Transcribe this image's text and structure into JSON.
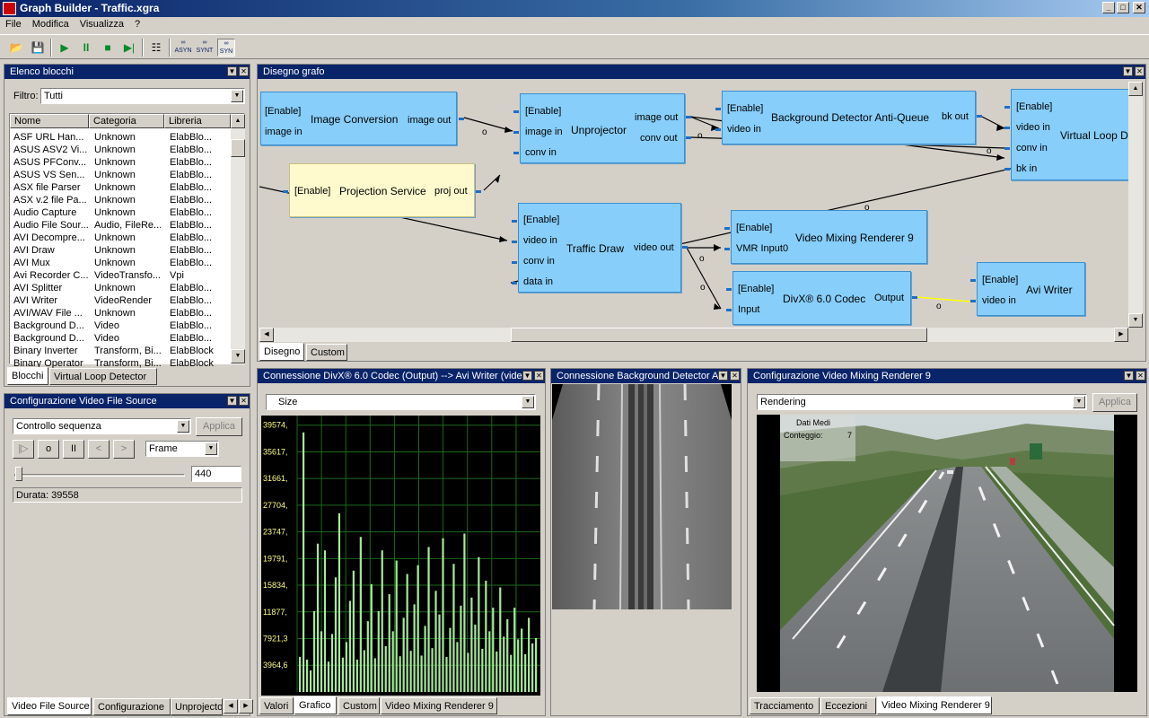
{
  "window": {
    "title": "Graph Builder - Traffic.xgra",
    "min": "_",
    "max": "□",
    "close": "✕"
  },
  "menu": [
    "File",
    "Modifica",
    "Visualizza",
    "?"
  ],
  "toolbar": {
    "asyn": "ASYN",
    "synt": "SYNT",
    "syn": "SYN"
  },
  "blocks_panel": {
    "title": "Elenco blocchi",
    "filter_label": "Filtro:",
    "filter_value": "Tutti",
    "columns": [
      "Nome",
      "Categoria",
      "Libreria"
    ],
    "rows": [
      [
        "ASF URL Han...",
        "Unknown",
        "ElabBlo..."
      ],
      [
        "ASUS ASV2 Vi...",
        "Unknown",
        "ElabBlo..."
      ],
      [
        "ASUS PFConv...",
        "Unknown",
        "ElabBlo..."
      ],
      [
        "ASUS VS Sen...",
        "Unknown",
        "ElabBlo..."
      ],
      [
        "ASX file Parser",
        "Unknown",
        "ElabBlo..."
      ],
      [
        "ASX v.2 file Pa...",
        "Unknown",
        "ElabBlo..."
      ],
      [
        "Audio Capture",
        "Unknown",
        "ElabBlo..."
      ],
      [
        "Audio File Sour...",
        "Audio, FileRe...",
        "ElabBlo..."
      ],
      [
        "AVI Decompre...",
        "Unknown",
        "ElabBlo..."
      ],
      [
        "AVI Draw",
        "Unknown",
        "ElabBlo..."
      ],
      [
        "AVI Mux",
        "Unknown",
        "ElabBlo..."
      ],
      [
        "Avi Recorder C...",
        "VideoTransfo...",
        "Vpi"
      ],
      [
        "AVI Splitter",
        "Unknown",
        "ElabBlo..."
      ],
      [
        "AVI Writer",
        "VideoRender",
        "ElabBlo..."
      ],
      [
        "AVI/WAV File ...",
        "Unknown",
        "ElabBlo..."
      ],
      [
        "Background D...",
        "Video",
        "ElabBlo..."
      ],
      [
        "Background D...",
        "Video",
        "ElabBlo..."
      ],
      [
        "Binary Inverter",
        "Transform, Bi...",
        "ElabBlock"
      ],
      [
        "Binary Operator",
        "Transform, Bi...",
        "ElabBlock"
      ]
    ],
    "tabs": [
      "Blocchi",
      "Virtual Loop Detector"
    ]
  },
  "vfs_panel": {
    "title": "Configurazione Video File Source",
    "combo": "Controllo sequenza",
    "apply": "Applica",
    "play": "|▷",
    "stop": "o",
    "pause": "II",
    "prev": "<",
    "next": ">",
    "unit": "Frame",
    "frame_value": "440",
    "duration": "Durata: 39558",
    "tabs": [
      "Video File Source",
      "Configurazione",
      "Unprojector"
    ]
  },
  "graph_panel": {
    "title": "Disegno grafo",
    "tabs": [
      "Disegno",
      "Custom"
    ],
    "blocks": {
      "image_conversion": {
        "name": "Image Conversion",
        "pins": [
          "[Enable]",
          "image in",
          "image out"
        ]
      },
      "unprojector": {
        "name": "Unprojector",
        "pins": [
          "[Enable]",
          "image in",
          "conv in",
          "image out",
          "conv out"
        ]
      },
      "bg_detector": {
        "name": "Background Detector Anti-Queue",
        "pins": [
          "[Enable]",
          "video in",
          "bk out"
        ]
      },
      "virtual_loop": {
        "name": "Virtual Loop D",
        "pins": [
          "[Enable]",
          "video in",
          "conv in",
          "bk in"
        ]
      },
      "projection": {
        "name": "Projection Service",
        "pins": [
          "[Enable]",
          "proj out"
        ]
      },
      "traffic_draw": {
        "name": "Traffic Draw",
        "pins": [
          "[Enable]",
          "video in",
          "conv in",
          "data in",
          "video out"
        ]
      },
      "vmr9": {
        "name": "Video Mixing Renderer 9",
        "pins": [
          "[Enable]",
          "VMR Input0"
        ]
      },
      "divx": {
        "name": "DivX® 6.0 Codec",
        "pins": [
          "[Enable]",
          "Input",
          "Output"
        ]
      },
      "avi_writer": {
        "name": "Avi Writer",
        "pins": [
          "[Enable]",
          "video in"
        ]
      }
    },
    "conn_label": "o"
  },
  "conn_panel": {
    "title": "Connessione DivX® 6.0 Codec (Output) --> Avi Writer (video",
    "combo": "Size",
    "tabs": [
      "Valori",
      "Grafico",
      "Custom",
      "Video Mixing Renderer 9"
    ]
  },
  "chart_data": {
    "type": "bar",
    "title": "",
    "ylabel": "",
    "ylim": [
      0,
      41000
    ],
    "yticks": [
      "39574,",
      "35617,",
      "31661,",
      "27704,",
      "23747,",
      "19791,",
      "15834,",
      "11877,",
      "7921,3",
      "3964,6"
    ],
    "ytick_values": [
      39574,
      35617,
      31661,
      27704,
      23747,
      19791,
      15834,
      11877,
      7921,
      3965
    ],
    "series": [
      {
        "values": [
          5200,
          38500,
          4800,
          3200,
          12000,
          22000,
          9000,
          21000,
          4500,
          8600,
          17000,
          26500,
          5100,
          7400,
          13500,
          18000,
          4800,
          23000,
          6200,
          10500,
          16000,
          5000,
          12000,
          21000,
          6800,
          14500,
          9000,
          19500,
          5300,
          11000,
          17500,
          6100,
          13000,
          18800,
          5400,
          9800,
          21500,
          6500,
          15000,
          11500,
          22800,
          5200,
          9500,
          19000,
          7400,
          12800,
          23500,
          5800,
          14000,
          10000,
          20000,
          6400,
          16500,
          9000,
          12500,
          6000,
          15500,
          8200,
          10800,
          5500,
          12500,
          7800,
          9400,
          5600,
          11000,
          7200,
          8000
        ]
      }
    ]
  },
  "bg_conn_panel": {
    "title": "Connessione Background Detector A"
  },
  "vmr_panel": {
    "title": "Configurazione Video Mixing Renderer 9",
    "combo": "Rendering",
    "apply": "Applica",
    "overlay_title": "Dati Medi",
    "overlay_count_label": "Conteggio:",
    "overlay_count": "7",
    "tabs": [
      "Tracciamento",
      "Eccezioni",
      "Video Mixing Renderer 9"
    ]
  },
  "colors": {
    "title_bar": "#0a246a",
    "block": "#87cefa",
    "block_selected": "#fffacd",
    "chart_bar": "#a8e89c",
    "grid": "#1a6a1a"
  }
}
